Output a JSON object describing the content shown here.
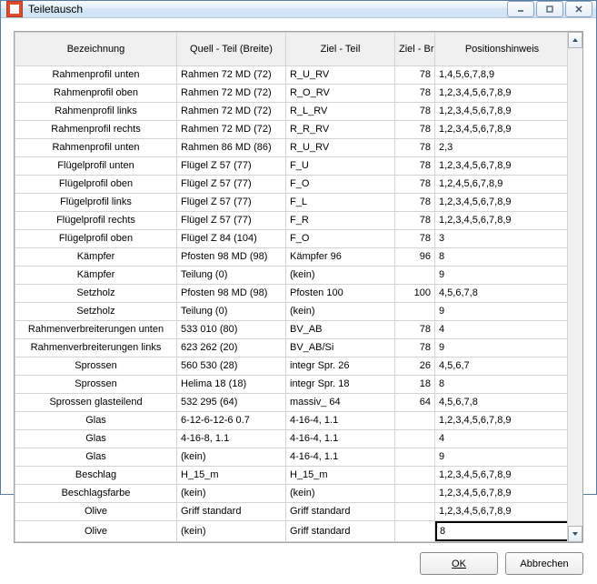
{
  "window": {
    "title": "Teiletausch"
  },
  "columns": {
    "bez": "Bezeichnung",
    "quell": "Quell - Teil (Breite)",
    "ziel": "Ziel - Teil",
    "zb": "Ziel - Breite",
    "pos": "Positionshinweis"
  },
  "rows": [
    {
      "bez": "Rahmenprofil unten",
      "quell": "Rahmen 72 MD (72)",
      "ziel": "R_U_RV",
      "zb": "78",
      "pos": "1,4,5,6,7,8,9"
    },
    {
      "bez": "Rahmenprofil oben",
      "quell": "Rahmen 72 MD (72)",
      "ziel": "R_O_RV",
      "zb": "78",
      "pos": "1,2,3,4,5,6,7,8,9"
    },
    {
      "bez": "Rahmenprofil links",
      "quell": "Rahmen 72 MD (72)",
      "ziel": "R_L_RV",
      "zb": "78",
      "pos": "1,2,3,4,5,6,7,8,9"
    },
    {
      "bez": "Rahmenprofil rechts",
      "quell": "Rahmen 72 MD (72)",
      "ziel": "R_R_RV",
      "zb": "78",
      "pos": "1,2,3,4,5,6,7,8,9"
    },
    {
      "bez": "Rahmenprofil unten",
      "quell": "Rahmen 86 MD (86)",
      "ziel": "R_U_RV",
      "zb": "78",
      "pos": "2,3"
    },
    {
      "bez": "Flügelprofil unten",
      "quell": "Flügel Z 57 (77)",
      "ziel": "F_U",
      "zb": "78",
      "pos": "1,2,3,4,5,6,7,8,9"
    },
    {
      "bez": "Flügelprofil oben",
      "quell": "Flügel Z 57 (77)",
      "ziel": "F_O",
      "zb": "78",
      "pos": "1,2,4,5,6,7,8,9"
    },
    {
      "bez": "Flügelprofil links",
      "quell": "Flügel Z 57 (77)",
      "ziel": "F_L",
      "zb": "78",
      "pos": "1,2,3,4,5,6,7,8,9"
    },
    {
      "bez": "Flügelprofil rechts",
      "quell": "Flügel Z 57 (77)",
      "ziel": "F_R",
      "zb": "78",
      "pos": "1,2,3,4,5,6,7,8,9"
    },
    {
      "bez": "Flügelprofil oben",
      "quell": "Flügel Z 84 (104)",
      "ziel": "F_O",
      "zb": "78",
      "pos": "3"
    },
    {
      "bez": "Kämpfer",
      "quell": "Pfosten 98 MD (98)",
      "ziel": " Kämpfer 96",
      "zb": "96",
      "pos": "8"
    },
    {
      "bez": "Kämpfer",
      "quell": "Teilung (0)",
      "ziel": "(kein)",
      "zb": "",
      "pos": "9"
    },
    {
      "bez": "Setzholz",
      "quell": "Pfosten 98 MD (98)",
      "ziel": "Pfosten 100",
      "zb": "100",
      "pos": "4,5,6,7,8"
    },
    {
      "bez": "Setzholz",
      "quell": "Teilung (0)",
      "ziel": "(kein)",
      "zb": "",
      "pos": "9"
    },
    {
      "bez": "Rahmenverbreiterungen unten",
      "quell": "533 010 (80)",
      "ziel": "BV_AB",
      "zb": "78",
      "pos": "4"
    },
    {
      "bez": "Rahmenverbreiterungen links",
      "quell": "623 262 (20)",
      "ziel": "BV_AB/Si",
      "zb": "78",
      "pos": "9"
    },
    {
      "bez": "Sprossen",
      "quell": "560 530 (28)",
      "ziel": "integr Spr. 26",
      "zb": "26",
      "pos": "4,5,6,7"
    },
    {
      "bez": "Sprossen",
      "quell": "Helima 18 (18)",
      "ziel": "integr Spr. 18",
      "zb": "18",
      "pos": "8"
    },
    {
      "bez": "Sprossen glasteilend",
      "quell": "532 295 (64)",
      "ziel": "massiv_ 64",
      "zb": "64",
      "pos": "4,5,6,7,8"
    },
    {
      "bez": "Glas",
      "quell": "6-12-6-12-6 0.7",
      "ziel": "4-16-4, 1.1",
      "zb": "",
      "pos": "1,2,3,4,5,6,7,8,9"
    },
    {
      "bez": "Glas",
      "quell": "4-16-8, 1.1",
      "ziel": "4-16-4, 1.1",
      "zb": "",
      "pos": "4"
    },
    {
      "bez": "Glas",
      "quell": "(kein)",
      "ziel": "4-16-4, 1.1",
      "zb": "",
      "pos": "9"
    },
    {
      "bez": "Beschlag",
      "quell": "H_15_m",
      "ziel": "H_15_m",
      "zb": "",
      "pos": "1,2,3,4,5,6,7,8,9"
    },
    {
      "bez": "Beschlagsfarbe",
      "quell": "(kein)",
      "ziel": "(kein)",
      "zb": "",
      "pos": "1,2,3,4,5,6,7,8,9"
    },
    {
      "bez": "Olive",
      "quell": "Griff standard",
      "ziel": "Griff standard",
      "zb": "",
      "pos": "1,2,3,4,5,6,7,8,9"
    }
  ],
  "edit_row": {
    "bez": "Olive",
    "quell": "(kein)",
    "ziel": "Griff standard",
    "zb": "",
    "pos": "8"
  },
  "buttons": {
    "ok": "OK",
    "cancel": "Abbrechen"
  }
}
